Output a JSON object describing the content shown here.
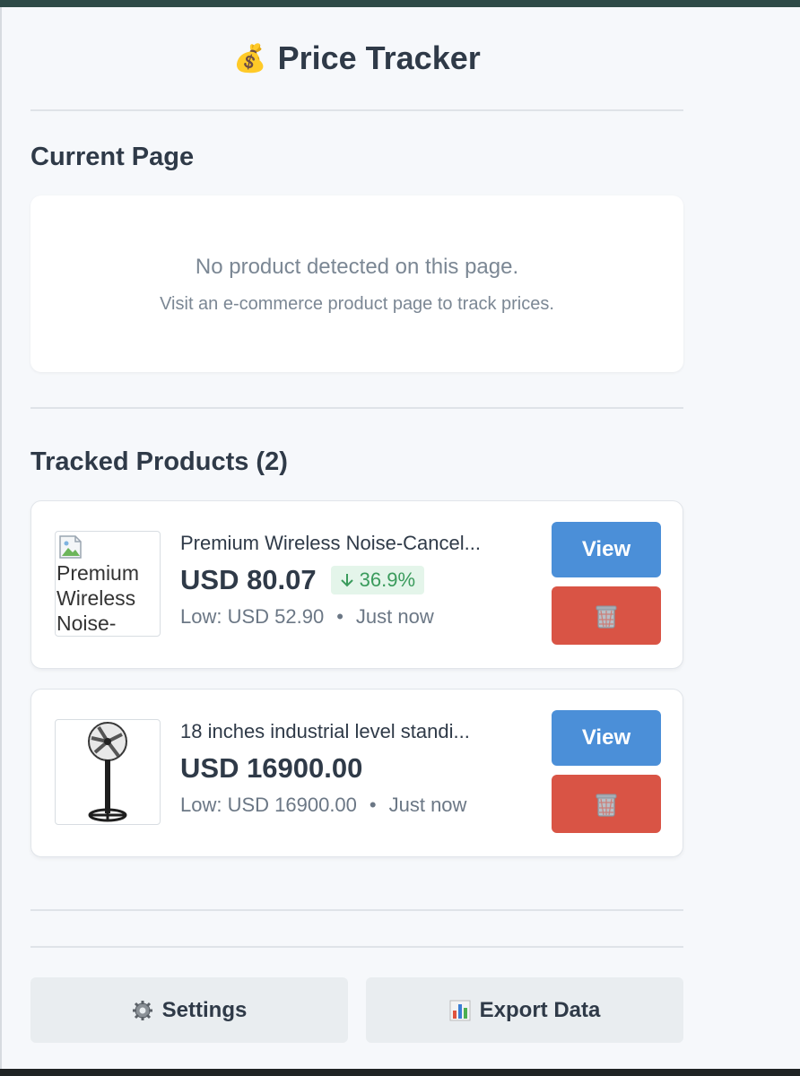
{
  "header": {
    "title": "Price Tracker",
    "icon": "money-bag-icon"
  },
  "current_page": {
    "heading": "Current Page",
    "empty_title": "No product detected on this page.",
    "empty_hint": "Visit an e-commerce product page to track prices."
  },
  "tracked": {
    "heading": "Tracked Products (2)",
    "products": [
      {
        "name": "Premium Wireless Noise-Cancel...",
        "image_alt": "Premium Wireless Noise-",
        "price": "USD 80.07",
        "change": "36.9%",
        "low": "Low: USD 52.90",
        "updated": "Just now",
        "view_label": "View"
      },
      {
        "name": "18 inches industrial level standi...",
        "price": "USD 16900.00",
        "low": "Low: USD 16900.00",
        "updated": "Just now",
        "view_label": "View"
      }
    ]
  },
  "footer": {
    "settings_label": "Settings",
    "export_label": "Export Data"
  },
  "colors": {
    "view_button": "#4b8fd8",
    "delete_button": "#d95445",
    "price_drop": "#3a9b5c",
    "price_drop_bg": "#e4f5ea"
  }
}
